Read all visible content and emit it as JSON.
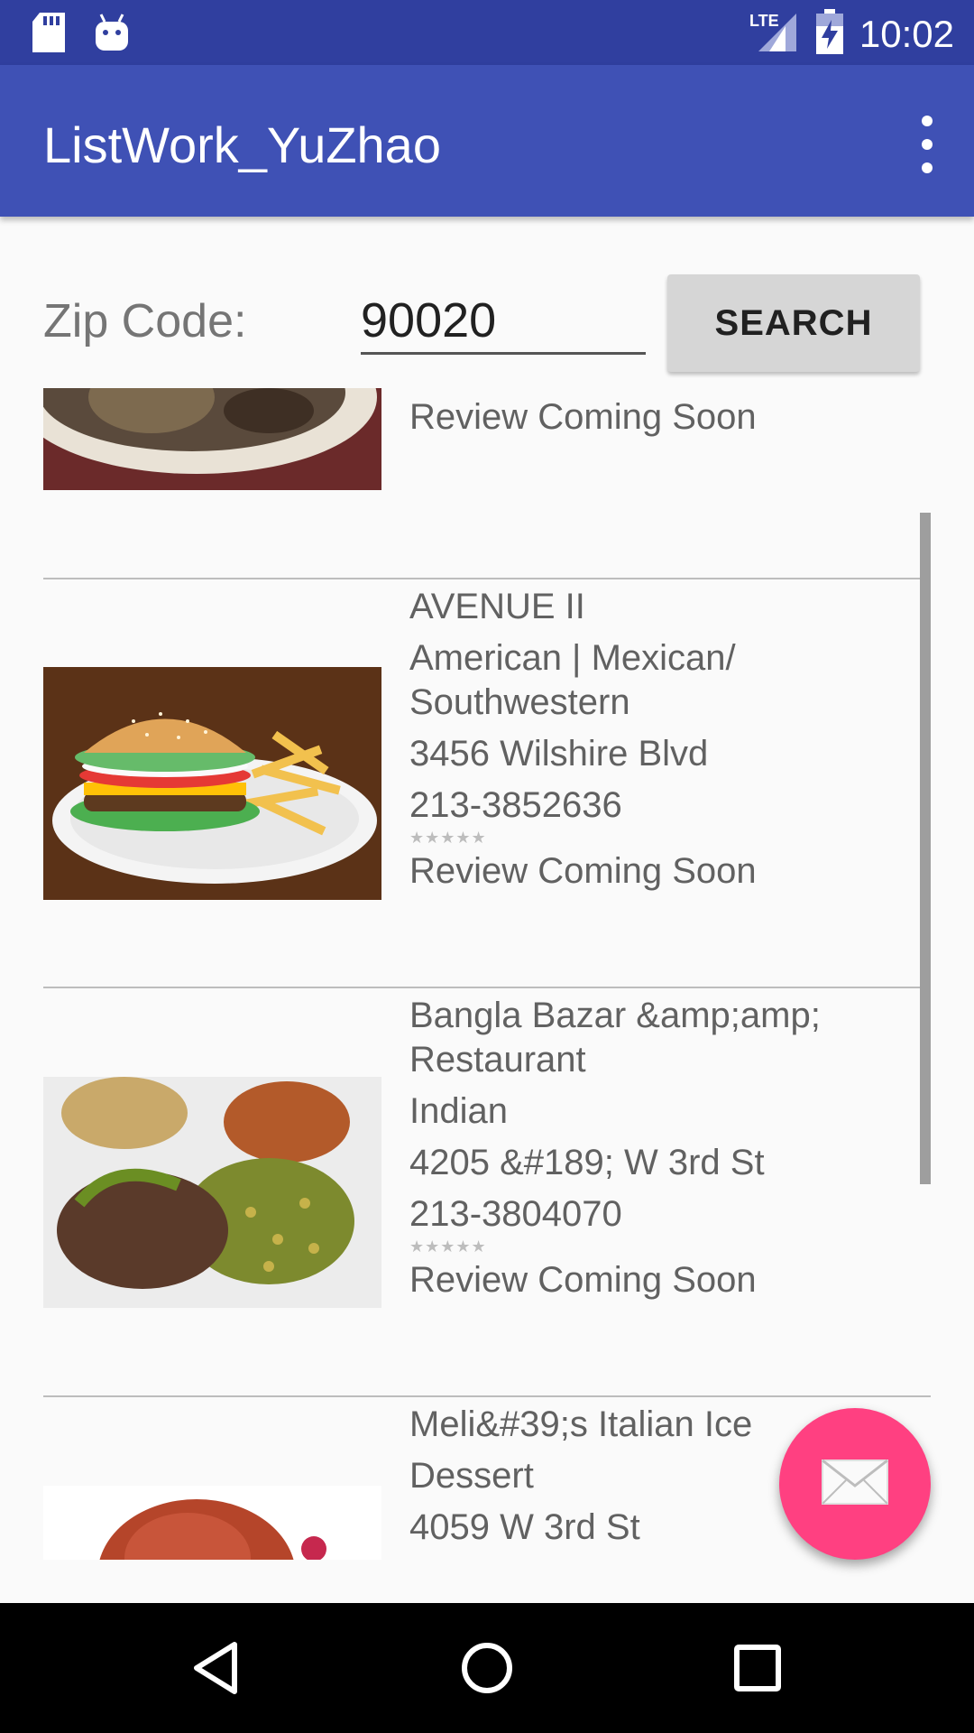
{
  "status_bar": {
    "time": "10:02",
    "network": "LTE",
    "icons": [
      "sd-card-icon",
      "android-debug-icon",
      "lte-signal-icon",
      "battery-charging-icon"
    ]
  },
  "app_bar": {
    "title": "ListWork_YuZhao",
    "menu_icon": "overflow-menu-icon",
    "background": "#3f51b5"
  },
  "search": {
    "label": "Zip Code:",
    "value": "90020",
    "button_label": "SEARCH"
  },
  "restaurants": [
    {
      "lines": [],
      "rating": "",
      "review": "Review Coming Soon",
      "image": "plate-with-food-image"
    },
    {
      "lines": [
        "AVENUE II",
        "American | Mexican/ Southwestern",
        "3456 Wilshire Blvd",
        "213-3852636"
      ],
      "rating": "★★★★★",
      "review": "Review Coming Soon",
      "image": "burger-and-fries-image"
    },
    {
      "lines": [
        "Bangla Bazar &amp;amp; Restaurant",
        "Indian",
        "4205 &#189; W 3rd St",
        "213-3804070"
      ],
      "rating": "★★★★★",
      "review": "Review Coming Soon",
      "image": "curry-takeout-box-image"
    },
    {
      "lines": [
        "Meli&#39;s Italian Ice",
        "Dessert",
        "4059 W 3rd St"
      ],
      "rating": "",
      "review": "",
      "image": "italian-ice-image"
    }
  ],
  "fab": {
    "icon": "email-icon",
    "color": "#ff4081"
  },
  "nav_bar": {
    "icons": [
      "back-icon",
      "home-icon",
      "recents-icon"
    ]
  },
  "colors": {
    "primary": "#3f51b5",
    "primary_dark": "#303f9f",
    "accent": "#ff4081"
  }
}
